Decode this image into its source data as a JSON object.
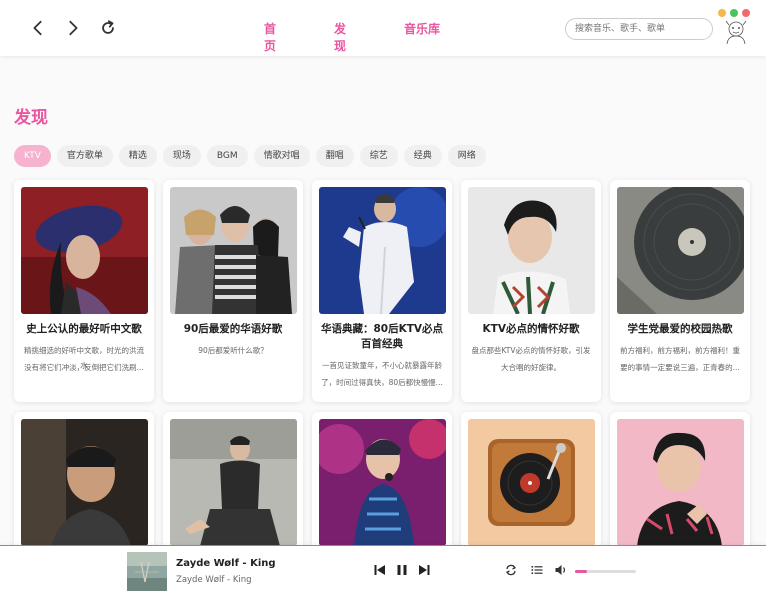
{
  "nav": {
    "tabs": [
      {
        "label": "首页"
      },
      {
        "label": "发现"
      },
      {
        "label": "音乐库"
      }
    ],
    "search_placeholder": "搜索音乐、歌手、歌单",
    "window_dots": [
      "#f5b74d",
      "#4cc35f",
      "#f26b6b"
    ]
  },
  "page": {
    "title": "发现",
    "accent": "#e957a0"
  },
  "categories": [
    {
      "label": "KTV",
      "active": true
    },
    {
      "label": "官方歌单"
    },
    {
      "label": "精选"
    },
    {
      "label": "现场"
    },
    {
      "label": "BGM"
    },
    {
      "label": "情歌对唱"
    },
    {
      "label": "翻唱"
    },
    {
      "label": "综艺"
    },
    {
      "label": "经典"
    },
    {
      "label": "网络"
    }
  ],
  "playlists": [
    {
      "title": "史上公认的最好听中文歌",
      "desc": [
        "精挑细选的好听中文歌，时光的洪流水",
        "没有将它们冲淡，反倒把它们洗刷..."
      ]
    },
    {
      "title": "90后最爱的华语好歌",
      "desc": [
        "90后都爱听什么歌？"
      ]
    },
    {
      "title": "华语典藏：80后KTV必点百首经典",
      "desc": [
        "一首见证致童年，不小心就暴露年龄",
        "了，时间过得真快，80后都快慢慢..."
      ]
    },
    {
      "title": "KTV必点的情怀好歌",
      "desc": [
        "盘点那些KTV必点的情怀好歌，引发",
        "大合唱的好旋律。"
      ]
    },
    {
      "title": "学生党最爱的校园热歌",
      "desc": [
        "前方福利，前方福利，前方福利！重",
        "要的事情一定要说三遍，正青春的..."
      ]
    },
    {
      "title": "",
      "desc": []
    },
    {
      "title": "",
      "desc": []
    },
    {
      "title": "",
      "desc": []
    },
    {
      "title": "",
      "desc": []
    },
    {
      "title": "",
      "desc": []
    }
  ],
  "player": {
    "title": "Zayde Wølf - King",
    "artist": "Zayde Wølf - King",
    "volume_fraction": 0.2
  }
}
